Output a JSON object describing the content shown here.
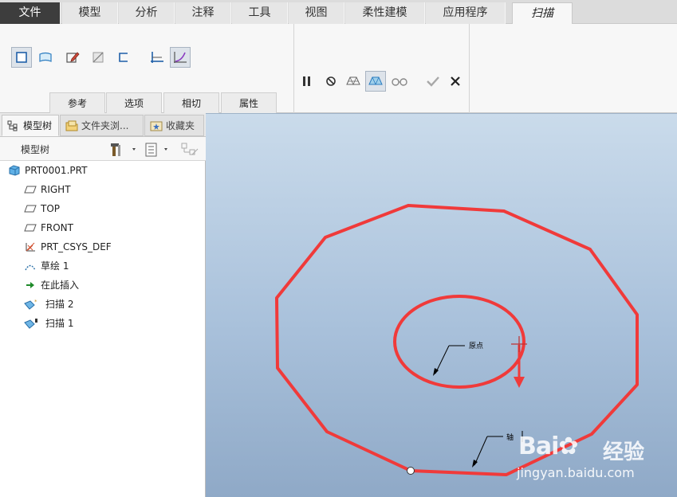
{
  "menu": {
    "tabs": [
      "文件",
      "模型",
      "分析",
      "注释",
      "工具",
      "视图",
      "柔性建模",
      "应用程序",
      "扫描"
    ],
    "active": "扫描"
  },
  "ribbon": {
    "subtabs": [
      "参考",
      "选项",
      "相切",
      "属性"
    ]
  },
  "navigator": {
    "tabs": [
      "模型树",
      "文件夹浏...",
      "收藏夹"
    ],
    "tree_title": "模型树"
  },
  "tree": {
    "items": [
      {
        "label": "PRT0001.PRT",
        "icon": "part-icon"
      },
      {
        "label": "RIGHT",
        "icon": "datum-plane-icon"
      },
      {
        "label": "TOP",
        "icon": "datum-plane-icon"
      },
      {
        "label": "FRONT",
        "icon": "datum-plane-icon"
      },
      {
        "label": "PRT_CSYS_DEF",
        "icon": "csys-icon"
      },
      {
        "label": "草绘 1",
        "icon": "sketch-icon"
      },
      {
        "label": "在此插入",
        "icon": "insert-here-arrow-icon"
      },
      {
        "label": "扫描 2",
        "icon": "sweep-icon"
      },
      {
        "label": "扫描 1",
        "icon": "sweep-icon"
      }
    ]
  },
  "canvas": {
    "label_origin": "原点",
    "label_axis": "轴",
    "curve_color": "#f03a3a"
  },
  "watermark": {
    "brand": "Bai",
    "brand_cn": "经验",
    "url": "jingyan.baidu.com"
  }
}
